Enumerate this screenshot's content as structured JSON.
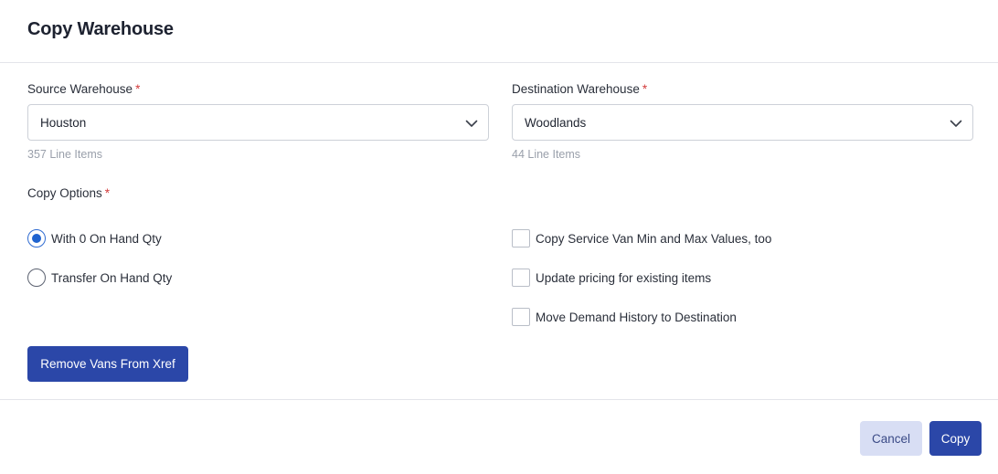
{
  "dialog": {
    "title": "Copy Warehouse"
  },
  "source": {
    "label": "Source Warehouse",
    "required_mark": "*",
    "value": "Houston",
    "line_items": "357 Line Items"
  },
  "destination": {
    "label": "Destination Warehouse",
    "required_mark": "*",
    "value": "Woodlands",
    "line_items": "44 Line Items"
  },
  "copy_options": {
    "label": "Copy Options",
    "required_mark": "*",
    "radios": [
      {
        "label": "With 0 On Hand Qty",
        "checked": true
      },
      {
        "label": "Transfer On Hand Qty",
        "checked": false
      }
    ],
    "checkboxes": [
      {
        "label": "Copy Service Van Min and Max Values, too",
        "checked": false
      },
      {
        "label": "Update pricing for existing items",
        "checked": false
      },
      {
        "label": "Move Demand History to Destination",
        "checked": false
      }
    ]
  },
  "actions": {
    "remove_vans": "Remove Vans From Xref",
    "cancel": "Cancel",
    "copy": "Copy"
  },
  "colors": {
    "primary": "#2b47a8",
    "secondary_bg": "#d8def4",
    "required": "#d23b3b",
    "radio_selected": "#1f63cf"
  }
}
